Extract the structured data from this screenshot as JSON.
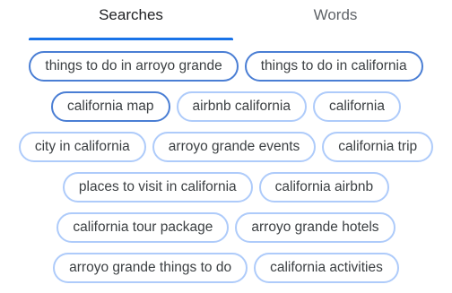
{
  "tabs": {
    "searches_label": "Searches",
    "words_label": "Words",
    "active": "Searches"
  },
  "chips": {
    "row1": [
      {
        "label": "things to do in arroyo grande",
        "selected": true
      },
      {
        "label": "things to do in california",
        "selected": true
      }
    ],
    "row2": [
      {
        "label": "california map",
        "selected": true
      },
      {
        "label": "airbnb california",
        "selected": false
      },
      {
        "label": "california",
        "selected": false
      }
    ],
    "row3": [
      {
        "label": "city in california",
        "selected": false
      },
      {
        "label": "arroyo grande events",
        "selected": false
      },
      {
        "label": "california trip",
        "selected": false
      }
    ],
    "row4": [
      {
        "label": "places to visit in california",
        "selected": false
      },
      {
        "label": "california airbnb",
        "selected": false
      }
    ],
    "row5": [
      {
        "label": "california tour package",
        "selected": false
      },
      {
        "label": "arroyo grande hotels",
        "selected": false
      }
    ],
    "row6": [
      {
        "label": "arroyo grande things to do",
        "selected": false
      },
      {
        "label": "california activities",
        "selected": false
      }
    ]
  },
  "colors": {
    "accent": "#1a73e8",
    "chip_border": "#aecbfa",
    "chip_border_selected": "#4a7ed4",
    "text": "#3c4043"
  }
}
